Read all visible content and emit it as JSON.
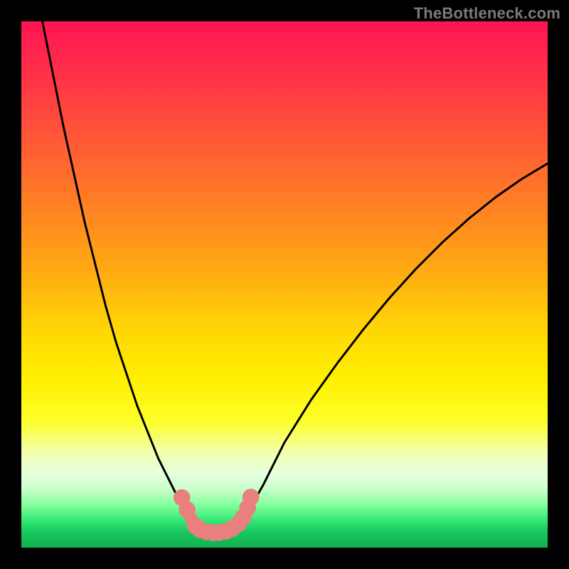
{
  "watermark": "TheBottleneck.com",
  "chart_data": {
    "type": "line",
    "title": "",
    "xlabel": "",
    "ylabel": "",
    "xlim": [
      0,
      100
    ],
    "ylim": [
      0,
      100
    ],
    "grid": false,
    "legend": false,
    "series": [
      {
        "name": "curve-left",
        "stroke": "#000000",
        "x": [
          4,
          6,
          8,
          10,
          12,
          14,
          16,
          18,
          20,
          22,
          24,
          26,
          28,
          30,
          31,
          32,
          33,
          34
        ],
        "y": [
          100,
          90,
          80,
          71,
          62,
          54,
          46,
          39,
          33,
          27,
          22,
          17,
          13,
          9,
          7.3,
          5.8,
          4.5,
          3.5
        ]
      },
      {
        "name": "curve-right",
        "stroke": "#000000",
        "x": [
          40,
          42,
          44,
          46,
          48,
          50,
          55,
          60,
          65,
          70,
          75,
          80,
          85,
          90,
          95,
          100
        ],
        "y": [
          3.5,
          5.5,
          8.5,
          12,
          16,
          20,
          28,
          35,
          41.5,
          47.5,
          53,
          58,
          62.5,
          66.5,
          70,
          73
        ]
      },
      {
        "name": "floor",
        "stroke": "#000000",
        "x": [
          34,
          35,
          36,
          37,
          38,
          39,
          40
        ],
        "y": [
          3.5,
          3.1,
          2.9,
          2.85,
          2.9,
          3.1,
          3.5
        ]
      }
    ],
    "markers": [
      {
        "x": 30.5,
        "y": 9.5,
        "r": 1.6,
        "color": "#e98080"
      },
      {
        "x": 31.5,
        "y": 7.2,
        "r": 1.6,
        "color": "#e98080"
      },
      {
        "x": 32.2,
        "y": 5.6,
        "r": 1.2,
        "color": "#e98080"
      },
      {
        "x": 33.0,
        "y": 4.2,
        "r": 1.6,
        "color": "#e98080"
      },
      {
        "x": 34.0,
        "y": 3.4,
        "r": 1.6,
        "color": "#e98080"
      },
      {
        "x": 35.2,
        "y": 3.0,
        "r": 1.6,
        "color": "#e98080"
      },
      {
        "x": 36.4,
        "y": 2.85,
        "r": 1.6,
        "color": "#e98080"
      },
      {
        "x": 37.6,
        "y": 2.9,
        "r": 1.6,
        "color": "#e98080"
      },
      {
        "x": 38.8,
        "y": 3.1,
        "r": 1.6,
        "color": "#e98080"
      },
      {
        "x": 40.0,
        "y": 3.6,
        "r": 1.6,
        "color": "#e98080"
      },
      {
        "x": 41.2,
        "y": 4.5,
        "r": 1.6,
        "color": "#e98080"
      },
      {
        "x": 42.2,
        "y": 5.8,
        "r": 1.6,
        "color": "#e98080"
      },
      {
        "x": 43.0,
        "y": 7.6,
        "r": 1.6,
        "color": "#e98080"
      },
      {
        "x": 43.6,
        "y": 9.6,
        "r": 1.6,
        "color": "#e98080"
      }
    ],
    "colors": {
      "gradient_top": "#ff1452",
      "gradient_bottom": "#10b050",
      "frame": "#000000",
      "marker": "#e98080"
    }
  }
}
